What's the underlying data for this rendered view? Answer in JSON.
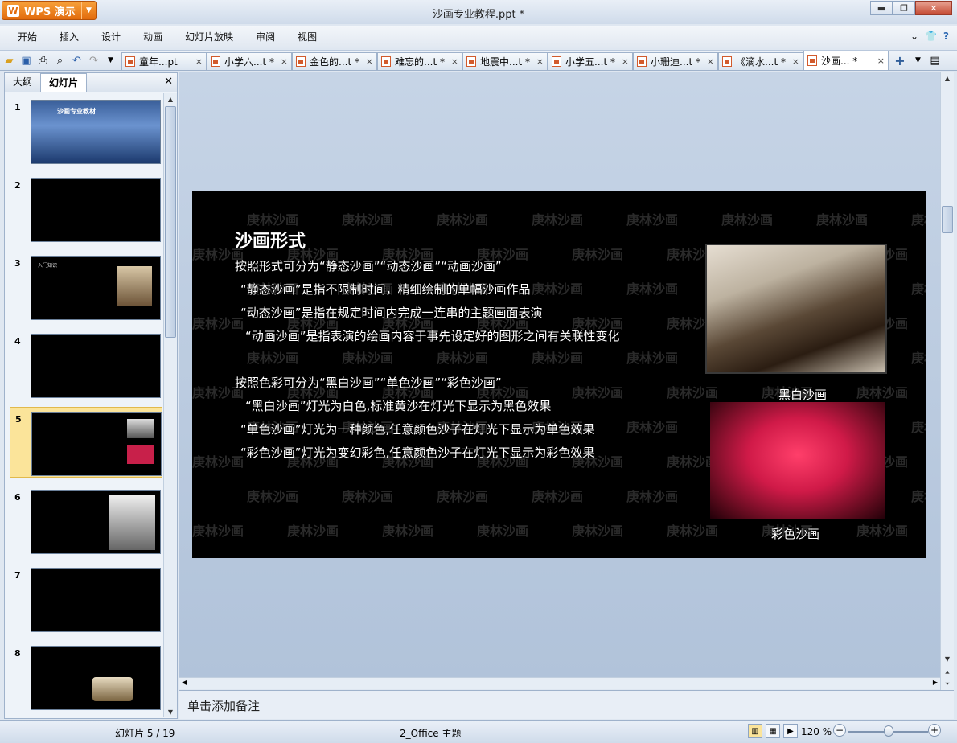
{
  "app": {
    "button_label": "WPS 演示",
    "doc_title": "沙画专业教程.ppt *"
  },
  "menu": [
    "开始",
    "插入",
    "设计",
    "动画",
    "幻灯片放映",
    "审阅",
    "视图"
  ],
  "doc_tabs": [
    {
      "label": "童年...pt",
      "close": "×"
    },
    {
      "label": "小学六...t *",
      "close": "×"
    },
    {
      "label": "金色的...t *",
      "close": "×"
    },
    {
      "label": "难忘的...t *",
      "close": "×"
    },
    {
      "label": "地震中...t *",
      "close": "×"
    },
    {
      "label": "小学五...t *",
      "close": "×"
    },
    {
      "label": "小珊迪...t *",
      "close": "×"
    },
    {
      "label": "《滴水...t *",
      "close": "×"
    },
    {
      "label": "沙画... *",
      "close": "×"
    }
  ],
  "left_pane": {
    "tab_outline": "大纲",
    "tab_slides": "幻灯片",
    "thumbnails": [
      {
        "num": "1",
        "title": "沙画专业教材"
      },
      {
        "num": "2",
        "title": ""
      },
      {
        "num": "3",
        "title": "入门知识"
      },
      {
        "num": "4",
        "title": ""
      },
      {
        "num": "5",
        "title": ""
      },
      {
        "num": "6",
        "title": ""
      },
      {
        "num": "7",
        "title": ""
      },
      {
        "num": "8",
        "title": ""
      }
    ]
  },
  "slide": {
    "watermark": "庚林沙画",
    "title": "沙画形式",
    "lines": [
      "按照形式可分为“静态沙画”“动态沙画”“动画沙画”",
      "“静态沙画”是指不限制时间，精细绘制的单幅沙画作品",
      "“动态沙画”是指在规定时间内完成一连串的主题画面表演",
      "“动画沙画”是指表演的绘画内容于事先设定好的图形之间有关联性变化",
      "按照色彩可分为“黑白沙画”“单色沙画”“彩色沙画”",
      "“黑白沙画”灯光为白色,标准黄沙在灯光下显示为黑色效果",
      "“单色沙画”灯光为一种颜色,任意颜色沙子在灯光下显示为单色效果",
      "“彩色沙画”灯光为变幻彩色,任意颜色沙子在灯光下显示为彩色效果"
    ],
    "caption_bw": "黑白沙画",
    "caption_color": "彩色沙画"
  },
  "notes_placeholder": "单击添加备注",
  "status": {
    "slide_info": "幻灯片 5 / 19",
    "theme": "2_Office 主题",
    "zoom": "120 %"
  }
}
